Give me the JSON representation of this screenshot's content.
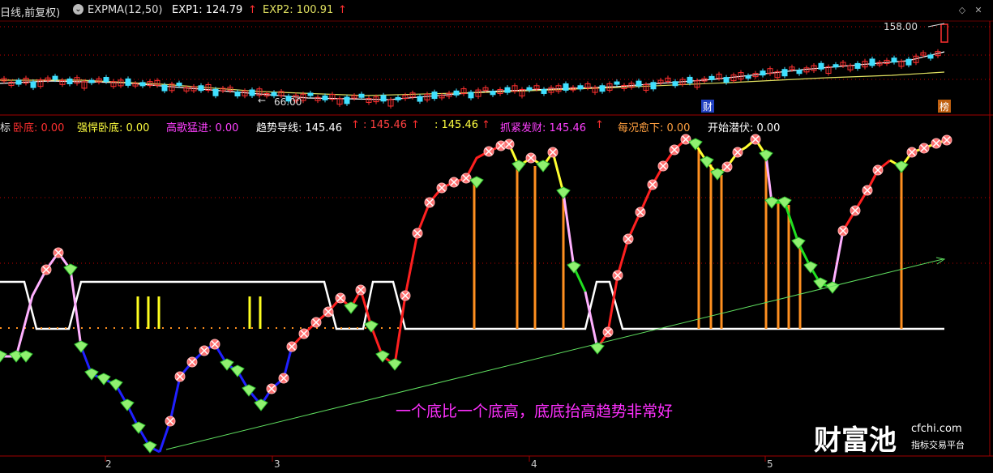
{
  "header": {
    "title": "日线,前复权)",
    "indicator": "EXPMA(12,50)",
    "exp1": "EXP1: 124.79",
    "exp2": "EXP2: 100.91",
    "up_arrow": "↑"
  },
  "price_panel": {
    "high_label": "158.00",
    "low_label": "66.00",
    "tag_cai": "财",
    "tag_bang": "榜"
  },
  "indicator_panel": {
    "left_cut": "标",
    "labels": [
      {
        "text": "卧底: 0.00",
        "color": "#ff3030"
      },
      {
        "text": "强悍卧底: 0.00",
        "color": "#ffff40"
      },
      {
        "text": "高歌猛进: 0.00",
        "color": "#ff40ff"
      },
      {
        "text": "趋势导线: 145.46",
        "color": "#ffffff",
        "arrow": "↑"
      },
      {
        "text": ": 145.46",
        "color": "#ff4040",
        "arrow": "↑"
      },
      {
        "text": ": 145.46",
        "color": "#ffff40",
        "arrow": "↑"
      },
      {
        "text": "抓紧发财: 145.46",
        "color": "#ff40ff",
        "arrow": "↑"
      },
      {
        "text": "每况愈下: 0.00",
        "color": "#ffa040"
      },
      {
        "text": "开始潜伏: 0.00",
        "color": "#ffffff"
      }
    ],
    "annotation": "一个底比一个底高，底底抬高趋势非常好"
  },
  "x_axis": {
    "labels": [
      "2",
      "3",
      "4",
      "5"
    ]
  },
  "watermark": {
    "brand": "财富池",
    "domain": "cfchi.com",
    "slogan": "指标交易平台"
  },
  "colors": {
    "up": "#ff3030",
    "down": "#40e0ff",
    "exp1": "#ffffff",
    "exp2": "#e0e060",
    "trend_up": "#ff2020",
    "trend_strong": "#ffff30",
    "trend_fade": "#ffb0ff",
    "trend_down": "#2020ff",
    "trend_weak": "#20e020",
    "bar": "#ff9020",
    "gridline": "#c00000"
  },
  "chart_data": [
    {
      "type": "line",
      "name": "price-candles",
      "ylim": [
        66,
        158
      ],
      "y_labels": [
        158,
        66
      ],
      "series": [
        {
          "name": "EXP1",
          "value": 124.79
        },
        {
          "name": "EXP2",
          "value": 100.91
        }
      ]
    },
    {
      "type": "line",
      "name": "trend-indicator",
      "ylim": [
        0,
        100
      ],
      "value": 145.46,
      "band_levels": [
        "high",
        "low"
      ]
    }
  ]
}
